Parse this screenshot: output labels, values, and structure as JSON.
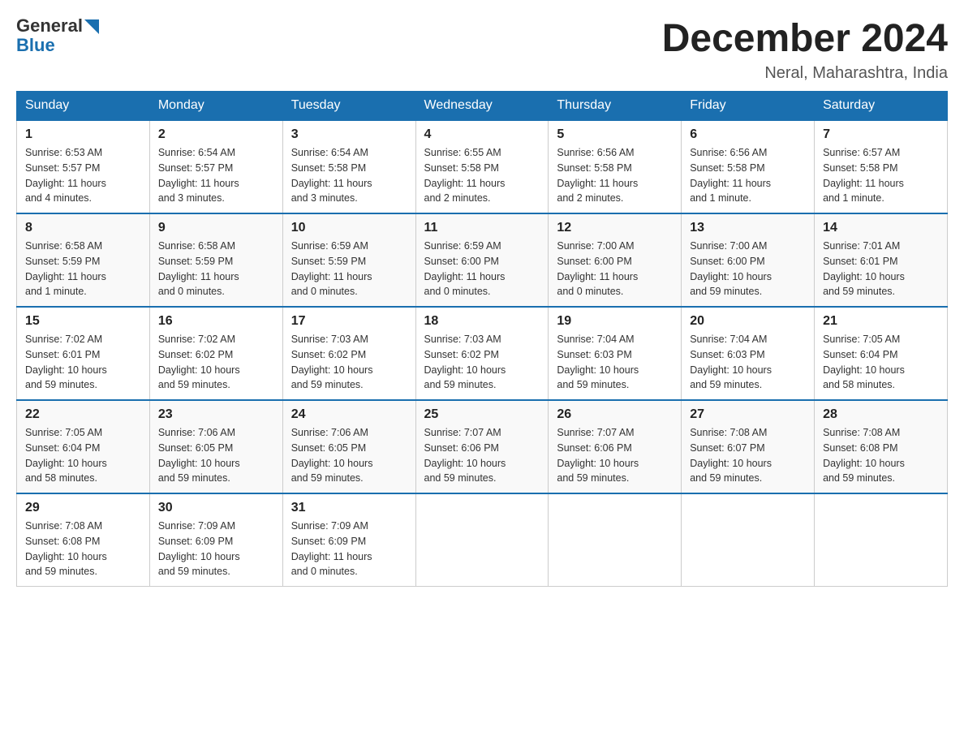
{
  "header": {
    "logo_line1": "General",
    "logo_line2": "Blue",
    "month_title": "December 2024",
    "location": "Neral, Maharashtra, India"
  },
  "weekdays": [
    "Sunday",
    "Monday",
    "Tuesday",
    "Wednesday",
    "Thursday",
    "Friday",
    "Saturday"
  ],
  "weeks": [
    [
      {
        "day": "1",
        "info": "Sunrise: 6:53 AM\nSunset: 5:57 PM\nDaylight: 11 hours\nand 4 minutes."
      },
      {
        "day": "2",
        "info": "Sunrise: 6:54 AM\nSunset: 5:57 PM\nDaylight: 11 hours\nand 3 minutes."
      },
      {
        "day": "3",
        "info": "Sunrise: 6:54 AM\nSunset: 5:58 PM\nDaylight: 11 hours\nand 3 minutes."
      },
      {
        "day": "4",
        "info": "Sunrise: 6:55 AM\nSunset: 5:58 PM\nDaylight: 11 hours\nand 2 minutes."
      },
      {
        "day": "5",
        "info": "Sunrise: 6:56 AM\nSunset: 5:58 PM\nDaylight: 11 hours\nand 2 minutes."
      },
      {
        "day": "6",
        "info": "Sunrise: 6:56 AM\nSunset: 5:58 PM\nDaylight: 11 hours\nand 1 minute."
      },
      {
        "day": "7",
        "info": "Sunrise: 6:57 AM\nSunset: 5:58 PM\nDaylight: 11 hours\nand 1 minute."
      }
    ],
    [
      {
        "day": "8",
        "info": "Sunrise: 6:58 AM\nSunset: 5:59 PM\nDaylight: 11 hours\nand 1 minute."
      },
      {
        "day": "9",
        "info": "Sunrise: 6:58 AM\nSunset: 5:59 PM\nDaylight: 11 hours\nand 0 minutes."
      },
      {
        "day": "10",
        "info": "Sunrise: 6:59 AM\nSunset: 5:59 PM\nDaylight: 11 hours\nand 0 minutes."
      },
      {
        "day": "11",
        "info": "Sunrise: 6:59 AM\nSunset: 6:00 PM\nDaylight: 11 hours\nand 0 minutes."
      },
      {
        "day": "12",
        "info": "Sunrise: 7:00 AM\nSunset: 6:00 PM\nDaylight: 11 hours\nand 0 minutes."
      },
      {
        "day": "13",
        "info": "Sunrise: 7:00 AM\nSunset: 6:00 PM\nDaylight: 10 hours\nand 59 minutes."
      },
      {
        "day": "14",
        "info": "Sunrise: 7:01 AM\nSunset: 6:01 PM\nDaylight: 10 hours\nand 59 minutes."
      }
    ],
    [
      {
        "day": "15",
        "info": "Sunrise: 7:02 AM\nSunset: 6:01 PM\nDaylight: 10 hours\nand 59 minutes."
      },
      {
        "day": "16",
        "info": "Sunrise: 7:02 AM\nSunset: 6:02 PM\nDaylight: 10 hours\nand 59 minutes."
      },
      {
        "day": "17",
        "info": "Sunrise: 7:03 AM\nSunset: 6:02 PM\nDaylight: 10 hours\nand 59 minutes."
      },
      {
        "day": "18",
        "info": "Sunrise: 7:03 AM\nSunset: 6:02 PM\nDaylight: 10 hours\nand 59 minutes."
      },
      {
        "day": "19",
        "info": "Sunrise: 7:04 AM\nSunset: 6:03 PM\nDaylight: 10 hours\nand 59 minutes."
      },
      {
        "day": "20",
        "info": "Sunrise: 7:04 AM\nSunset: 6:03 PM\nDaylight: 10 hours\nand 59 minutes."
      },
      {
        "day": "21",
        "info": "Sunrise: 7:05 AM\nSunset: 6:04 PM\nDaylight: 10 hours\nand 58 minutes."
      }
    ],
    [
      {
        "day": "22",
        "info": "Sunrise: 7:05 AM\nSunset: 6:04 PM\nDaylight: 10 hours\nand 58 minutes."
      },
      {
        "day": "23",
        "info": "Sunrise: 7:06 AM\nSunset: 6:05 PM\nDaylight: 10 hours\nand 59 minutes."
      },
      {
        "day": "24",
        "info": "Sunrise: 7:06 AM\nSunset: 6:05 PM\nDaylight: 10 hours\nand 59 minutes."
      },
      {
        "day": "25",
        "info": "Sunrise: 7:07 AM\nSunset: 6:06 PM\nDaylight: 10 hours\nand 59 minutes."
      },
      {
        "day": "26",
        "info": "Sunrise: 7:07 AM\nSunset: 6:06 PM\nDaylight: 10 hours\nand 59 minutes."
      },
      {
        "day": "27",
        "info": "Sunrise: 7:08 AM\nSunset: 6:07 PM\nDaylight: 10 hours\nand 59 minutes."
      },
      {
        "day": "28",
        "info": "Sunrise: 7:08 AM\nSunset: 6:08 PM\nDaylight: 10 hours\nand 59 minutes."
      }
    ],
    [
      {
        "day": "29",
        "info": "Sunrise: 7:08 AM\nSunset: 6:08 PM\nDaylight: 10 hours\nand 59 minutes."
      },
      {
        "day": "30",
        "info": "Sunrise: 7:09 AM\nSunset: 6:09 PM\nDaylight: 10 hours\nand 59 minutes."
      },
      {
        "day": "31",
        "info": "Sunrise: 7:09 AM\nSunset: 6:09 PM\nDaylight: 11 hours\nand 0 minutes."
      },
      {
        "day": "",
        "info": ""
      },
      {
        "day": "",
        "info": ""
      },
      {
        "day": "",
        "info": ""
      },
      {
        "day": "",
        "info": ""
      }
    ]
  ]
}
